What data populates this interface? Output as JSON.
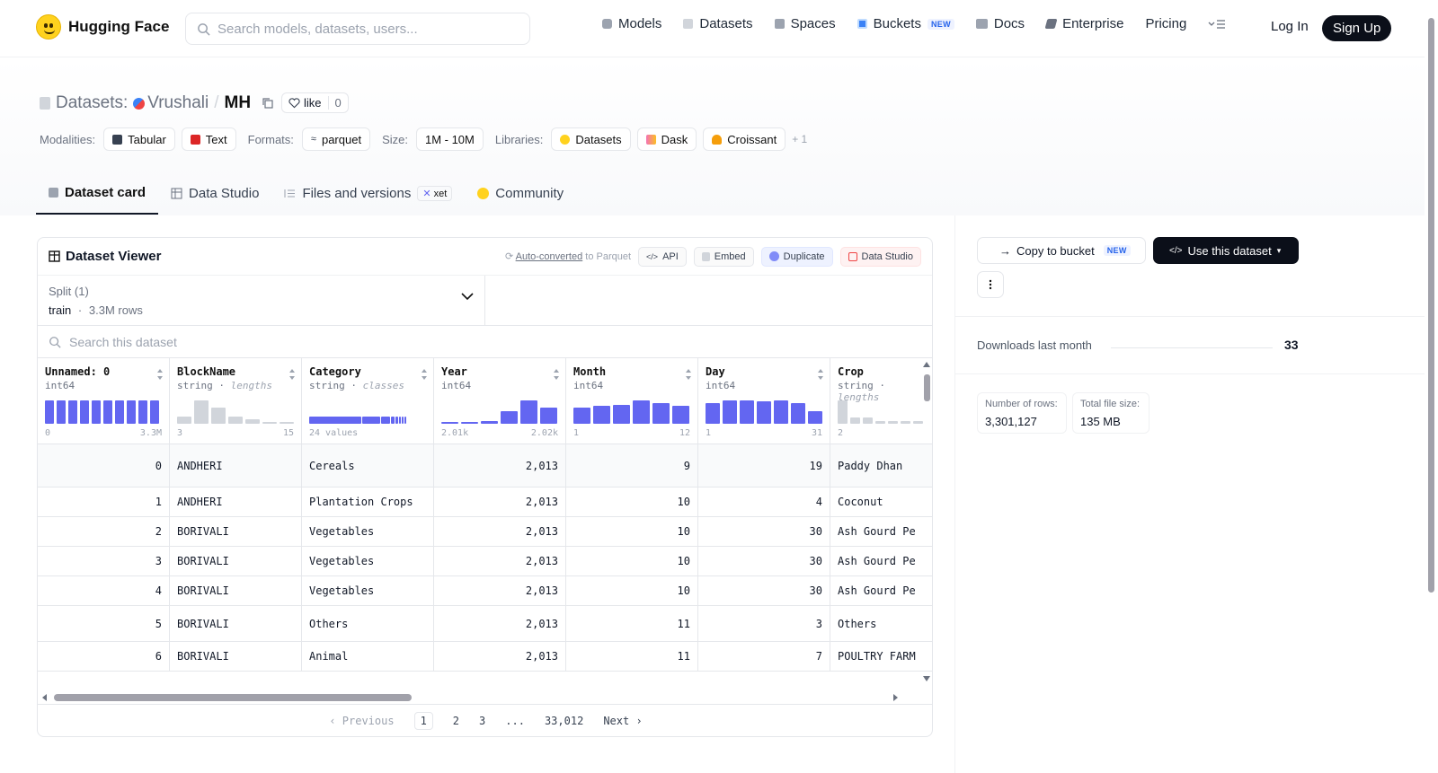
{
  "nav": {
    "brand": "Hugging Face",
    "search_placeholder": "Search models, datasets, users...",
    "links": [
      {
        "label": "Models",
        "icon": "models-cube-icon",
        "color": "#9ca3af"
      },
      {
        "label": "Datasets",
        "icon": "datasets-stack-icon",
        "color": "#d1d5db"
      },
      {
        "label": "Spaces",
        "icon": "spaces-grid-icon",
        "color": "#9ca3af"
      },
      {
        "label": "Buckets",
        "icon": "bucket-icon",
        "color": "#3b82f6",
        "badge": "NEW"
      },
      {
        "label": "Docs",
        "icon": "docs-book-icon",
        "color": "#9ca3af"
      },
      {
        "label": "Enterprise",
        "icon": "enterprise-icon",
        "color": "#6b7280"
      },
      {
        "label": "Pricing"
      }
    ],
    "login": "Log In",
    "signup": "Sign Up"
  },
  "repo": {
    "prefix": "Datasets:",
    "owner": "Vrushali",
    "separator": "/",
    "name": "MH",
    "like_label": "like",
    "like_count": "0"
  },
  "tags": {
    "modalities_label": "Modalities:",
    "modalities": [
      "Tabular",
      "Text"
    ],
    "formats_label": "Formats:",
    "formats": [
      "parquet"
    ],
    "size_label": "Size:",
    "size": "1M - 10M",
    "libraries_label": "Libraries:",
    "libraries": [
      "Datasets",
      "Dask",
      "Croissant"
    ],
    "more": "+ 1"
  },
  "tabs": [
    {
      "label": "Dataset card",
      "active": true
    },
    {
      "label": "Data Studio"
    },
    {
      "label": "Files and versions",
      "badge": "xet"
    },
    {
      "label": "Community"
    }
  ],
  "viewer": {
    "title": "Dataset Viewer",
    "auto_link": "Auto-converted",
    "auto_rest": " to Parquet",
    "api": "API",
    "embed": "Embed",
    "duplicate": "Duplicate",
    "data_studio": "Data Studio",
    "split_label": "Split (1)",
    "split_name": "train",
    "split_dot": "·",
    "split_rows": "3.3M rows",
    "search_placeholder": "Search this dataset",
    "columns": [
      {
        "name": "Unnamed: 0",
        "type": "int64",
        "min": "0",
        "max": "3.3M",
        "hist": [
          1,
          1,
          1,
          1,
          1,
          1,
          1,
          1,
          1,
          1
        ],
        "style": "blue"
      },
      {
        "name": "BlockName",
        "type": "string",
        "sub": "lengths",
        "min": "3",
        "max": "15",
        "hist": [
          0.3,
          1,
          0.7,
          0.3,
          0.2,
          0.05,
          0.05
        ],
        "style": "gray"
      },
      {
        "name": "Category",
        "type": "string",
        "sub": "classes",
        "min": "24 values",
        "max": "",
        "hist": [],
        "style": "classes"
      },
      {
        "name": "Year",
        "type": "int64",
        "min": "2.01k",
        "max": "2.02k",
        "hist": [
          0.05,
          0.07,
          0.1,
          0.55,
          1,
          0.7
        ],
        "style": "blue"
      },
      {
        "name": "Month",
        "type": "int64",
        "min": "1",
        "max": "12",
        "hist": [
          0.7,
          0.75,
          0.8,
          1,
          0.9,
          0.75
        ],
        "style": "blue"
      },
      {
        "name": "Day",
        "type": "int64",
        "min": "1",
        "max": "31",
        "hist": [
          0.9,
          1,
          1,
          0.95,
          1,
          0.9,
          0.55
        ],
        "style": "blue"
      },
      {
        "name": "Crop",
        "type": "string",
        "sub": "lengths",
        "min": "2",
        "max": "",
        "hist": [
          1,
          0.25,
          0.25,
          0.1,
          0.1,
          0.1,
          0.1
        ],
        "style": "gray"
      }
    ],
    "rows": [
      [
        "0",
        "ANDHERI",
        "Cereals",
        "2,013",
        "9",
        "19",
        "Paddy Dhan"
      ],
      [
        "1",
        "ANDHERI",
        "Plantation Crops",
        "2,013",
        "10",
        "4",
        "Coconut"
      ],
      [
        "2",
        "BORIVALI",
        "Vegetables",
        "2,013",
        "10",
        "30",
        "Ash Gourd Pe"
      ],
      [
        "3",
        "BORIVALI",
        "Vegetables",
        "2,013",
        "10",
        "30",
        "Ash Gourd Pe"
      ],
      [
        "4",
        "BORIVALI",
        "Vegetables",
        "2,013",
        "10",
        "30",
        "Ash Gourd Pe"
      ],
      [
        "5",
        "BORIVALI",
        "Others",
        "2,013",
        "11",
        "3",
        "Others"
      ],
      [
        "6",
        "BORIVALI",
        "Animal",
        "2,013",
        "11",
        "7",
        "POULTRY FARM"
      ]
    ],
    "pager": {
      "prev": "Previous",
      "pages": [
        "1",
        "2",
        "3",
        "...",
        "33,012"
      ],
      "next": "Next"
    }
  },
  "sidebar": {
    "copy_bucket": "Copy to bucket",
    "copy_badge": "NEW",
    "use_dataset": "Use this dataset",
    "downloads_label": "Downloads last month",
    "downloads_value": "33",
    "rows_label": "Number of rows:",
    "rows_value": "3,301,127",
    "size_label": "Total file size:",
    "size_value": "135 MB"
  },
  "colors": {
    "accent": "#6366f1",
    "dark": "#0b0f19",
    "brand": "#ffd21e"
  }
}
